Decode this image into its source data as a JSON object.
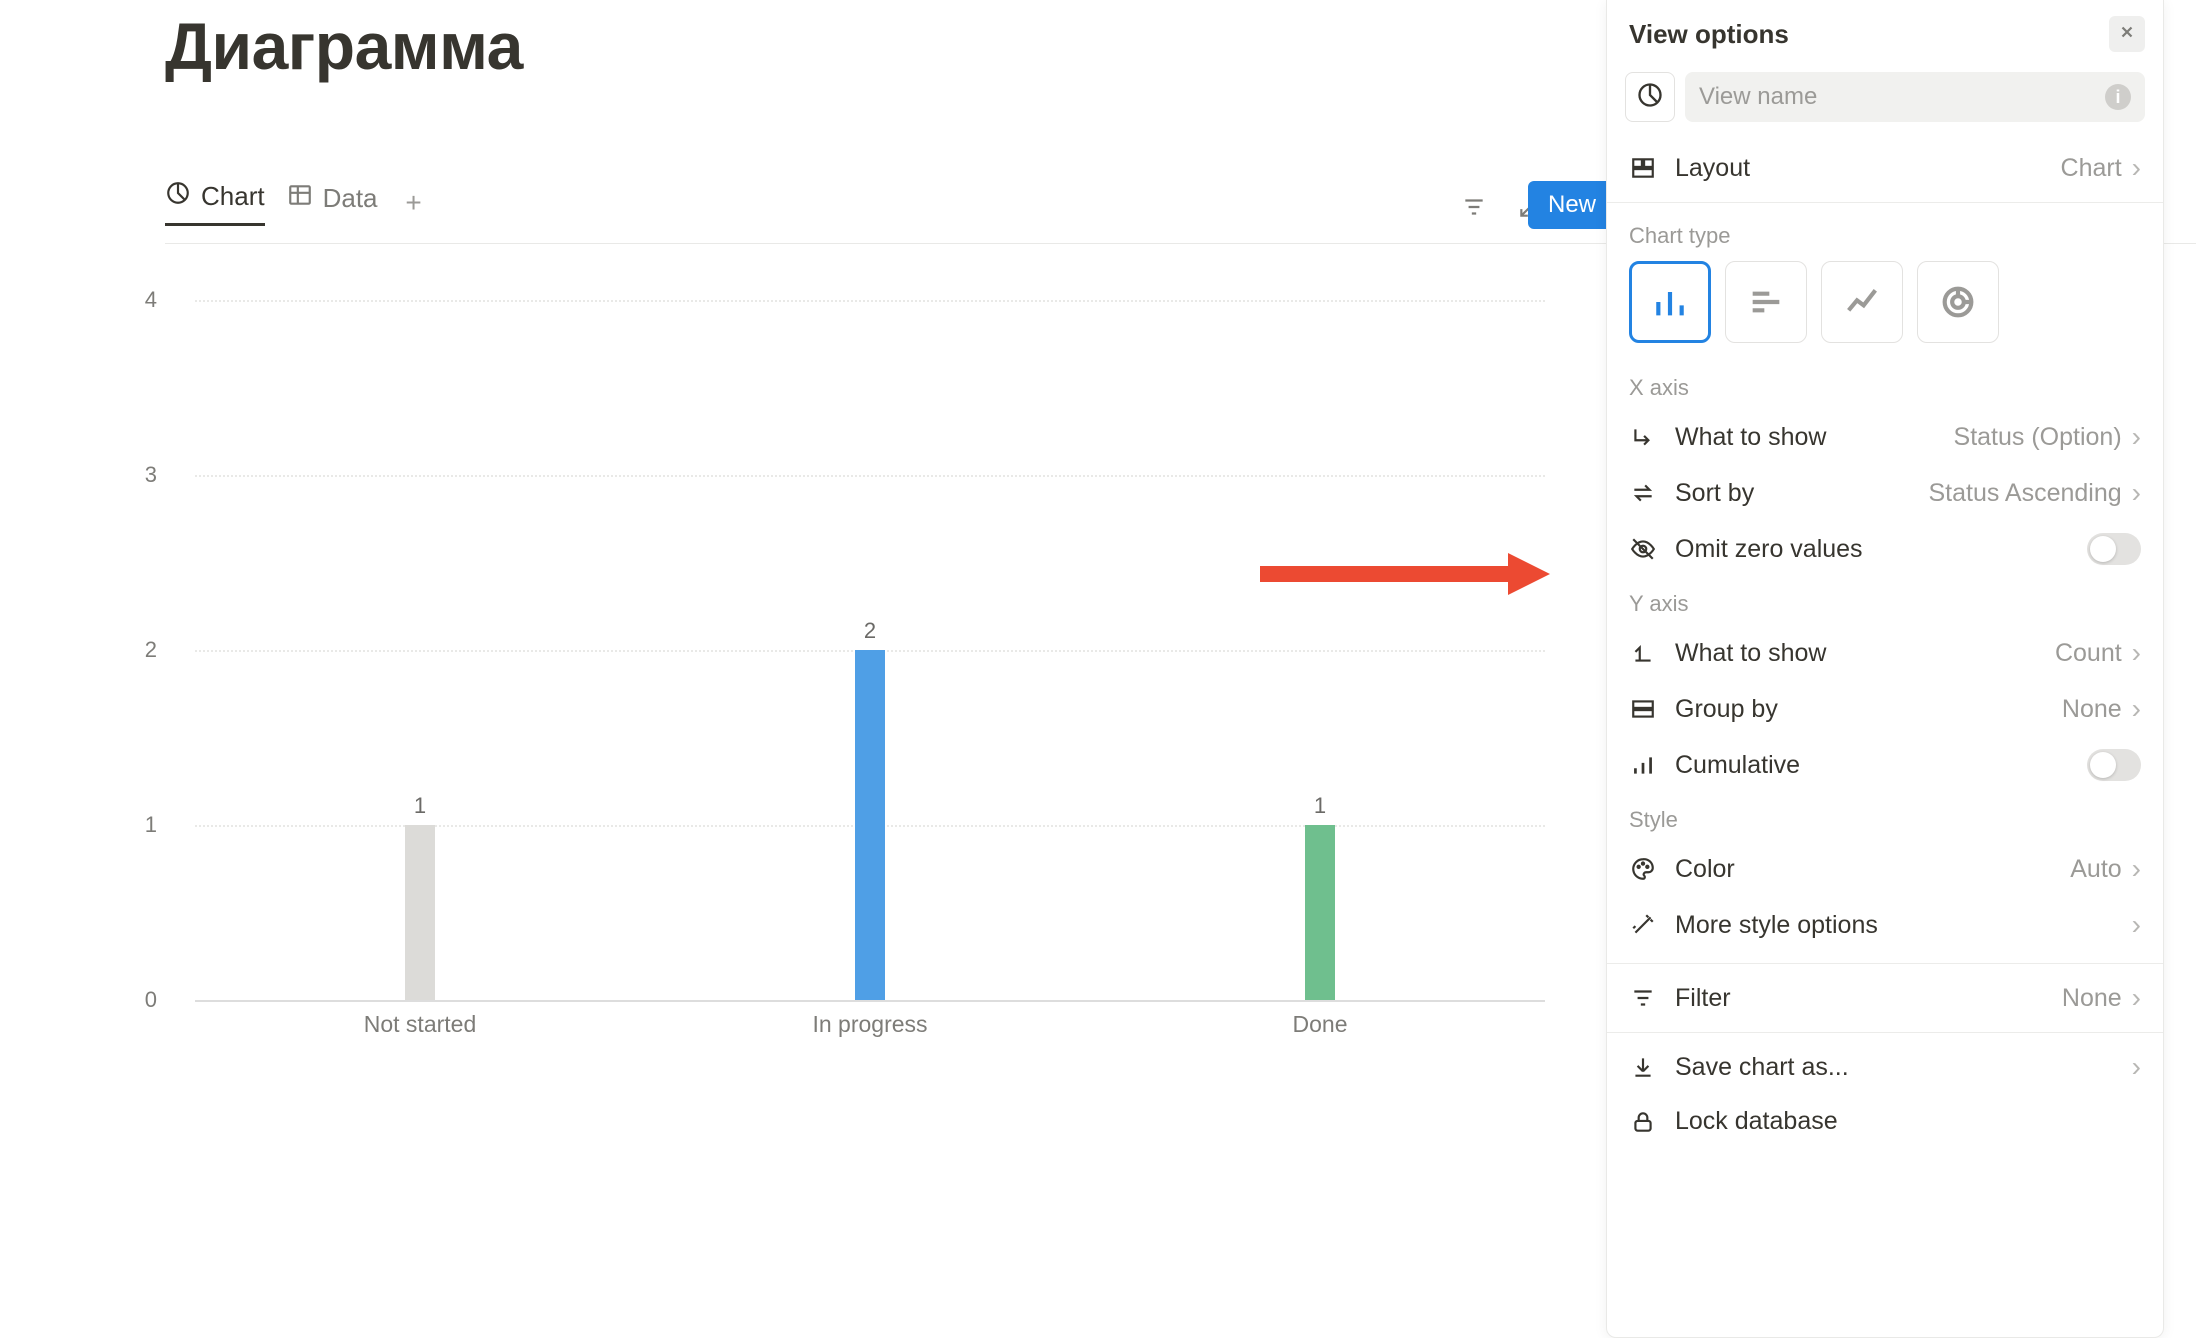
{
  "page_title": "Диаграмма",
  "tabs": {
    "chart": "Chart",
    "data": "Data"
  },
  "toolbar": {
    "new_label": "New"
  },
  "chart_data": {
    "type": "bar",
    "categories": [
      "Not started",
      "In progress",
      "Done"
    ],
    "values": [
      1,
      2,
      1
    ],
    "colors": [
      "#dcdbd8",
      "#4f9fe6",
      "#6fbf8e"
    ],
    "ylim": [
      0,
      4
    ],
    "yticks": [
      0,
      1,
      2,
      3,
      4
    ],
    "ylabel": "",
    "xlabel": "",
    "title": ""
  },
  "panel": {
    "title": "View options",
    "view_name_placeholder": "View name",
    "layout": {
      "label": "Layout",
      "value": "Chart"
    },
    "chart_type_label": "Chart type",
    "x_axis": {
      "label": "X axis",
      "what_to_show": {
        "label": "What to show",
        "value": "Status (Option)"
      },
      "sort_by": {
        "label": "Sort by",
        "value": "Status Ascending"
      },
      "omit_zero": {
        "label": "Omit zero values",
        "value": false
      }
    },
    "y_axis": {
      "label": "Y axis",
      "what_to_show": {
        "label": "What to show",
        "value": "Count"
      },
      "group_by": {
        "label": "Group by",
        "value": "None"
      },
      "cumulative": {
        "label": "Cumulative",
        "value": false
      }
    },
    "style": {
      "label": "Style",
      "color": {
        "label": "Color",
        "value": "Auto"
      },
      "more": {
        "label": "More style options"
      }
    },
    "filter": {
      "label": "Filter",
      "value": "None"
    },
    "save": {
      "label": "Save chart as..."
    },
    "lock": {
      "label": "Lock database"
    }
  }
}
